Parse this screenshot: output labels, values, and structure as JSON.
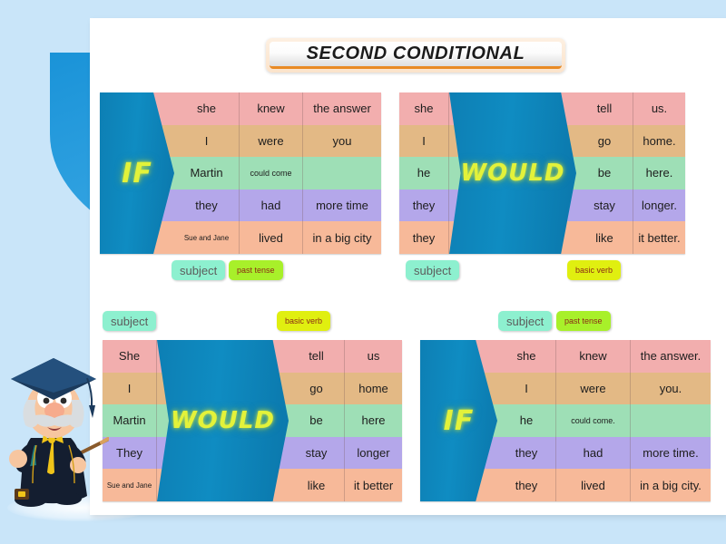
{
  "slide": {
    "title": "SECOND CONDITIONAL",
    "background_color": "#c9e5f9",
    "accent_color": "#0d7fb4",
    "highlight_color": "#e3f23a"
  },
  "legend": {
    "subject_label": "subject",
    "past_tense_label": "past tense",
    "basic_verb_label": "basic verb",
    "subject_color": "#8df0cf",
    "past_tense_color": "#a8f02a",
    "basic_verb_color": "#e0ef10"
  },
  "row_colors": [
    "#f2aeae",
    "#e3b985",
    "#9edfb6",
    "#b4a7ea",
    "#f7b999"
  ],
  "tables": {
    "top_left": {
      "keyword": "IF",
      "keyword_side": "left",
      "rows": [
        {
          "subject": "she",
          "verb": "knew",
          "object": "the answer"
        },
        {
          "subject": "I",
          "verb": "were",
          "object": "you"
        },
        {
          "subject": "Martin",
          "verb": "could come",
          "object": ""
        },
        {
          "subject": "they",
          "verb": "had",
          "object": "more time"
        },
        {
          "subject": "Sue and Jane",
          "verb": "lived",
          "object": "in a big city"
        }
      ]
    },
    "top_right": {
      "keyword": "WOULD",
      "keyword_side": "middle",
      "rows": [
        {
          "subject": "she",
          "verb": "tell",
          "object": "us."
        },
        {
          "subject": "I",
          "verb": "go",
          "object": "home."
        },
        {
          "subject": "he",
          "verb": "be",
          "object": "here."
        },
        {
          "subject": "they",
          "verb": "stay",
          "object": "longer."
        },
        {
          "subject": "they",
          "verb": "like",
          "object": "it better."
        }
      ]
    },
    "bottom_left": {
      "keyword": "WOULD",
      "keyword_side": "middle",
      "rows": [
        {
          "subject": "She",
          "verb": "tell",
          "object": "us"
        },
        {
          "subject": "I",
          "verb": "go",
          "object": "home"
        },
        {
          "subject": "Martin",
          "verb": "be",
          "object": "here"
        },
        {
          "subject": "They",
          "verb": "stay",
          "object": "longer"
        },
        {
          "subject": "Sue and Jane",
          "verb": "like",
          "object": "it better"
        }
      ]
    },
    "bottom_right": {
      "keyword": "IF",
      "keyword_side": "left",
      "rows": [
        {
          "subject": "she",
          "verb": "knew",
          "object": "the answer."
        },
        {
          "subject": "I",
          "verb": "were",
          "object": "you."
        },
        {
          "subject": "he",
          "verb": "could come.",
          "object": ""
        },
        {
          "subject": "they",
          "verb": "had",
          "object": "more time."
        },
        {
          "subject": "they",
          "verb": "lived",
          "object": "in a big city."
        }
      ]
    }
  },
  "professor": {
    "alt": "cartoon professor with graduation cap holding a pointer",
    "cap_color": "#1b3a5c",
    "robe_color": "#141e30",
    "bowtie_color": "#f0c419",
    "skin_color": "#f7c6a0",
    "hair_color": "#d9dde0"
  }
}
